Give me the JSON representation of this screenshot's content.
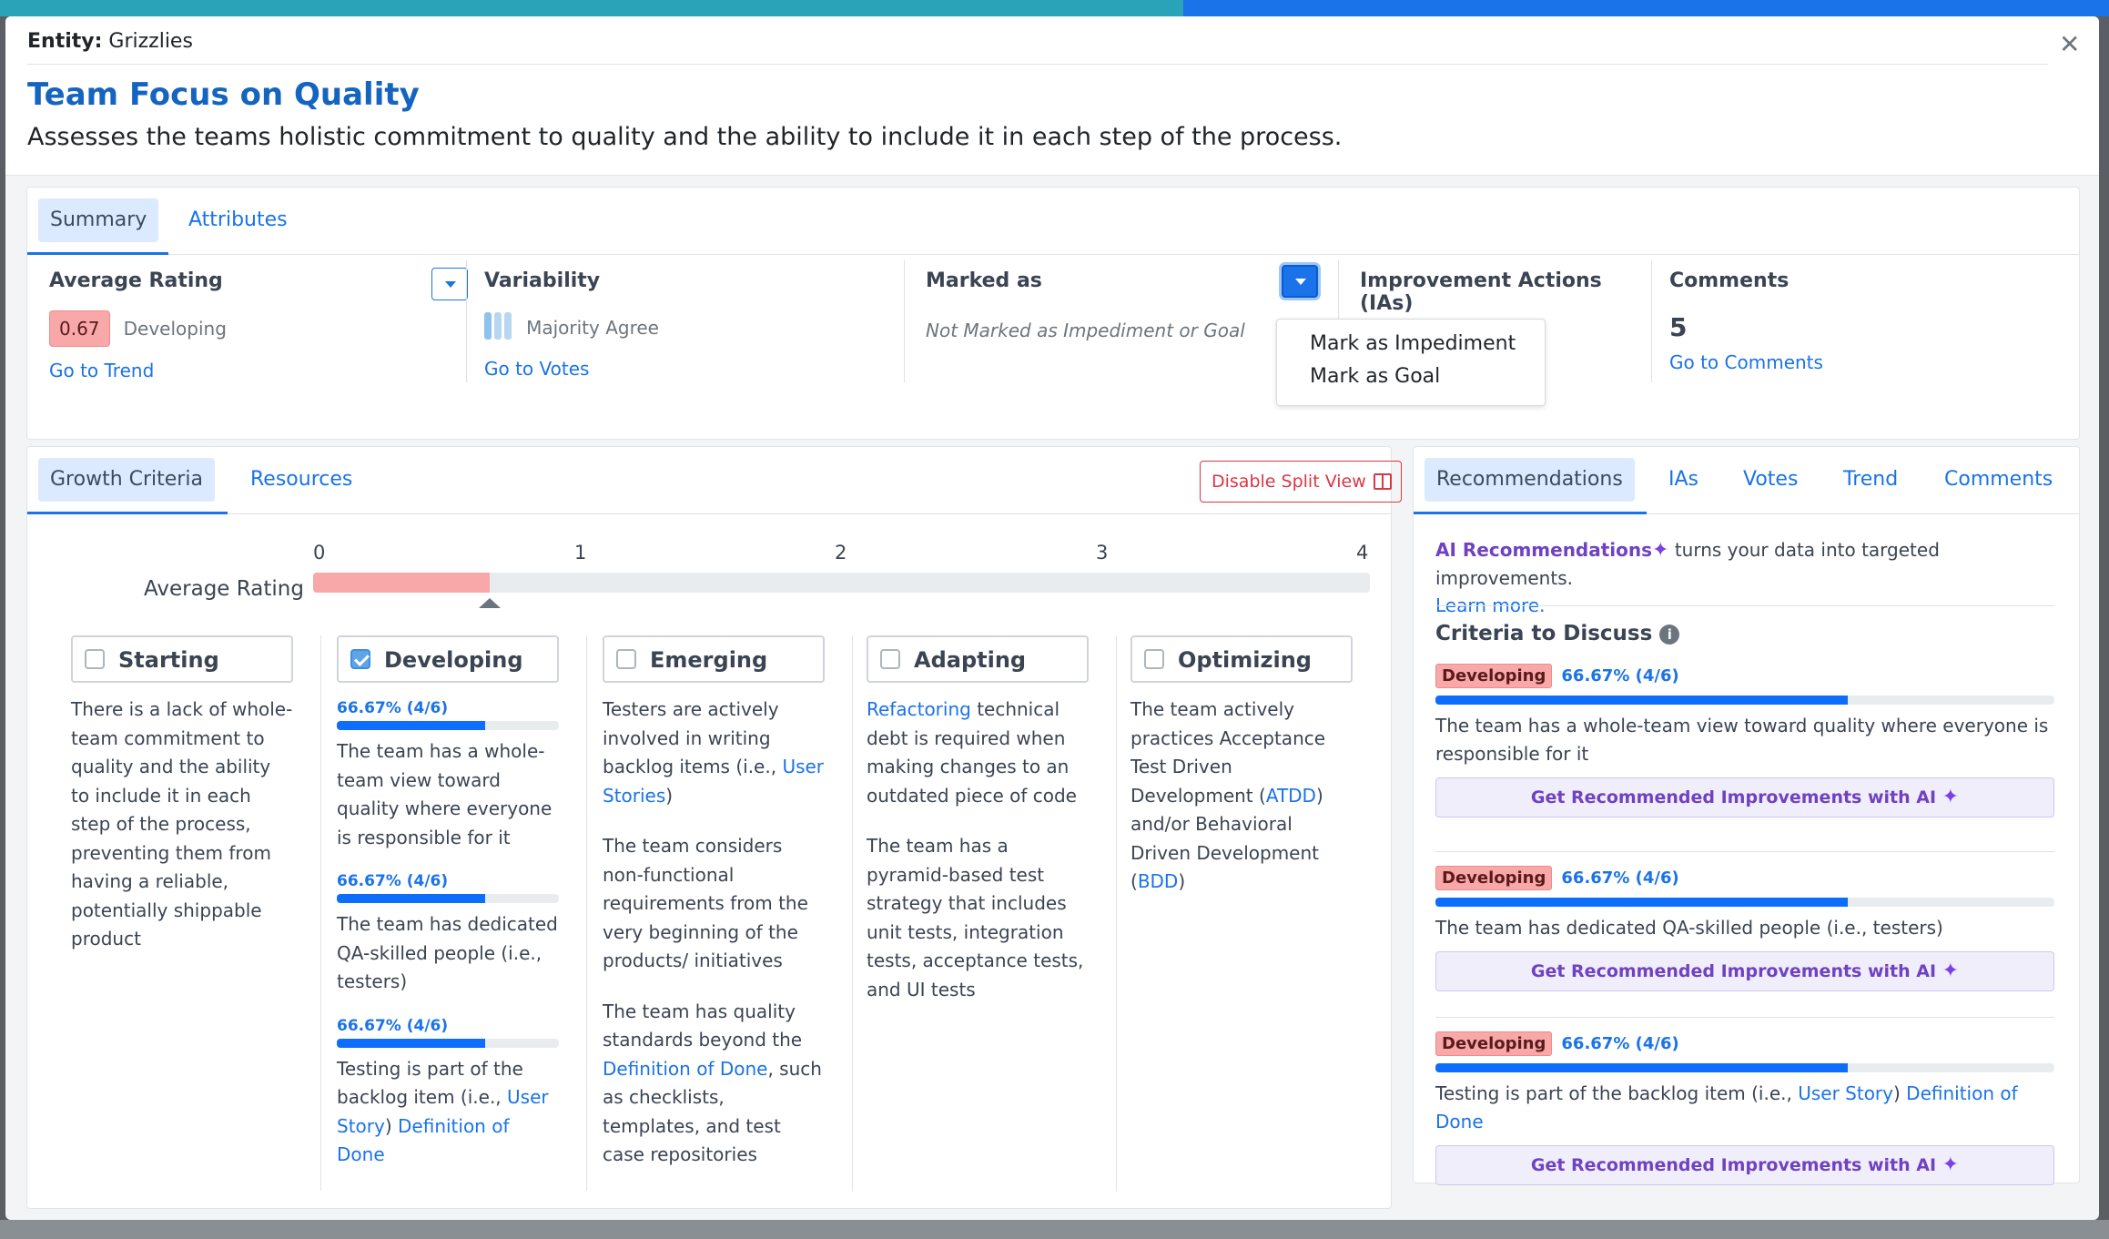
{
  "modal": {
    "entity_label": "Entity:",
    "entity_value": "Grizzlies",
    "title": "Team Focus on Quality",
    "subtitle": "Assesses the teams holistic commitment to quality and the ability to include it in each step of the process."
  },
  "summary_tabs": [
    "Summary",
    "Attributes"
  ],
  "summary": {
    "average_rating": {
      "label": "Average Rating",
      "value": "0.67",
      "level": "Developing",
      "link": "Go to Trend"
    },
    "variability": {
      "label": "Variability",
      "value": "Majority Agree",
      "link": "Go to Votes"
    },
    "marked_as": {
      "label": "Marked as",
      "value": "Not Marked as Impediment or Goal",
      "menu": [
        "Mark as Impediment",
        "Mark as Goal"
      ]
    },
    "improvement_actions": {
      "label": "Improvement Actions (IAs)"
    },
    "comments": {
      "label": "Comments",
      "count": "5",
      "link": "Go to Comments"
    }
  },
  "growth": {
    "tabs": [
      "Growth Criteria",
      "Resources"
    ],
    "split_button": "Disable Split View",
    "scale_label": "Average Rating",
    "scale_ticks": [
      "0",
      "1",
      "2",
      "3",
      "4"
    ],
    "scale_min": 0,
    "scale_max": 4,
    "rating_value": 0.67,
    "levels": [
      {
        "name": "Starting",
        "checked": false
      },
      {
        "name": "Developing",
        "checked": true
      },
      {
        "name": "Emerging",
        "checked": false
      },
      {
        "name": "Adapting",
        "checked": false
      },
      {
        "name": "Optimizing",
        "checked": false
      }
    ],
    "starting_text": "There is a lack of whole-team commitment to quality and the ability to include it in each step of the process, preventing them from having a reliable, potentially shippable product",
    "developing": [
      {
        "pct": "66.67% (4/6)",
        "fill": 0.6667,
        "text": "The team has a whole-team view toward quality where everyone is responsible for it"
      },
      {
        "pct": "66.67% (4/6)",
        "fill": 0.6667,
        "text": "The team has dedicated QA-skilled people (i.e., testers)"
      },
      {
        "pct": "66.67% (4/6)",
        "fill": 0.6667,
        "text_pre": "Testing is part of the backlog item (i.e.,",
        "link1": "User Story",
        "text_mid": ")",
        "link2": "Definition of Done"
      }
    ],
    "emerging": {
      "p1_pre": "Testers are actively involved in writing backlog items (i.e.,",
      "p1_link": "User Stories",
      "p1_post": ")",
      "p2": "The team considers non-functional requirements from the very beginning of the products/ initiatives",
      "p3_pre": "The team has quality standards beyond the",
      "p3_link": "Definition of Done",
      "p3_post": ", such as checklists, templates, and test case repositories"
    },
    "adapting": {
      "p1_link": "Refactoring",
      "p1_post": "technical debt is required when making changes to an outdated piece of code",
      "p2": "The team has a pyramid-based test strategy that includes unit tests, integration tests, acceptance tests, and UI tests"
    },
    "optimizing": {
      "p1_pre": "The team actively practices Acceptance Test Driven Development (",
      "link1": "ATDD",
      "p1_mid": ") and/or Behavioral Driven Development (",
      "link2": "BDD",
      "p1_post": ")"
    }
  },
  "right_panel": {
    "tabs": [
      "Recommendations",
      "IAs",
      "Votes",
      "Trend",
      "Comments"
    ],
    "ai_title": "AI Recommendations",
    "ai_desc": "turns your data into targeted improvements.",
    "learn_more": "Learn more.",
    "criteria_heading": "Criteria to Discuss",
    "button_label": "Get Recommended Improvements with AI",
    "items": [
      {
        "badge": "Developing",
        "pct": "66.67% (4/6)",
        "fill": 0.6667,
        "text": "The team has a whole-team view toward quality where everyone is responsible for it"
      },
      {
        "badge": "Developing",
        "pct": "66.67% (4/6)",
        "fill": 0.6667,
        "text": "The team has dedicated QA-skilled people (i.e., testers)"
      },
      {
        "badge": "Developing",
        "pct": "66.67% (4/6)",
        "fill": 0.6667,
        "text_pre": "Testing is part of the backlog item (i.e.,",
        "link1": "User Story",
        "text_mid": ")",
        "link2": "Definition of Done"
      }
    ]
  },
  "colors": {
    "accent": "#1a73e8",
    "title": "#1565c0",
    "rating_low": "#f8a8a8",
    "ai": "#6f42c1",
    "danger": "#dc3545"
  },
  "icons": [
    "close-icon",
    "chevron-down-icon",
    "split-view-icon",
    "sparkle-icon",
    "info-icon",
    "checkbox-icon"
  ]
}
